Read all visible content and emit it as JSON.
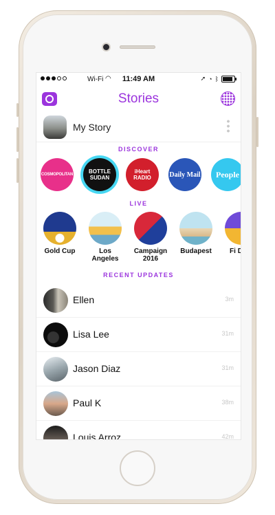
{
  "status_bar": {
    "carrier": "Wi-Fi",
    "time": "11:49 AM"
  },
  "header": {
    "title": "Stories"
  },
  "my_story": {
    "label": "My Story"
  },
  "discover": {
    "label": "DISCOVER",
    "channels": [
      {
        "name": "COSMOPOLITAN",
        "bg": "#e8308a",
        "fg": "#ffffff",
        "selected": false
      },
      {
        "name": "BOTTLE SUDAN",
        "bg": "#111111",
        "fg": "#ffffff",
        "selected": true
      },
      {
        "name": "iHeart RADIO",
        "bg": "#d21f2c",
        "fg": "#ffffff",
        "selected": false
      },
      {
        "name": "Daily Mail",
        "bg": "#2a56b8",
        "fg": "#ffffff",
        "selected": false
      },
      {
        "name": "People",
        "bg": "#35c8ef",
        "fg": "#ffffff",
        "selected": false
      }
    ]
  },
  "live": {
    "label": "LIVE",
    "events": [
      {
        "caption": "Gold Cup"
      },
      {
        "caption": "Los Angeles"
      },
      {
        "caption": "Campaign 2016"
      },
      {
        "caption": "Budapest"
      },
      {
        "caption": "Fi De S"
      }
    ]
  },
  "recent_updates": {
    "label": "RECENT UPDATES",
    "items": [
      {
        "name": "Ellen",
        "ago": "3m"
      },
      {
        "name": "Lisa Lee",
        "ago": "31m"
      },
      {
        "name": "Jason Diaz",
        "ago": "31m"
      },
      {
        "name": "Paul K",
        "ago": "38m"
      },
      {
        "name": "Louis Arroz",
        "ago": "42m"
      }
    ]
  },
  "colors": {
    "accent": "#9b34dd",
    "ring": "#47d7f2"
  }
}
